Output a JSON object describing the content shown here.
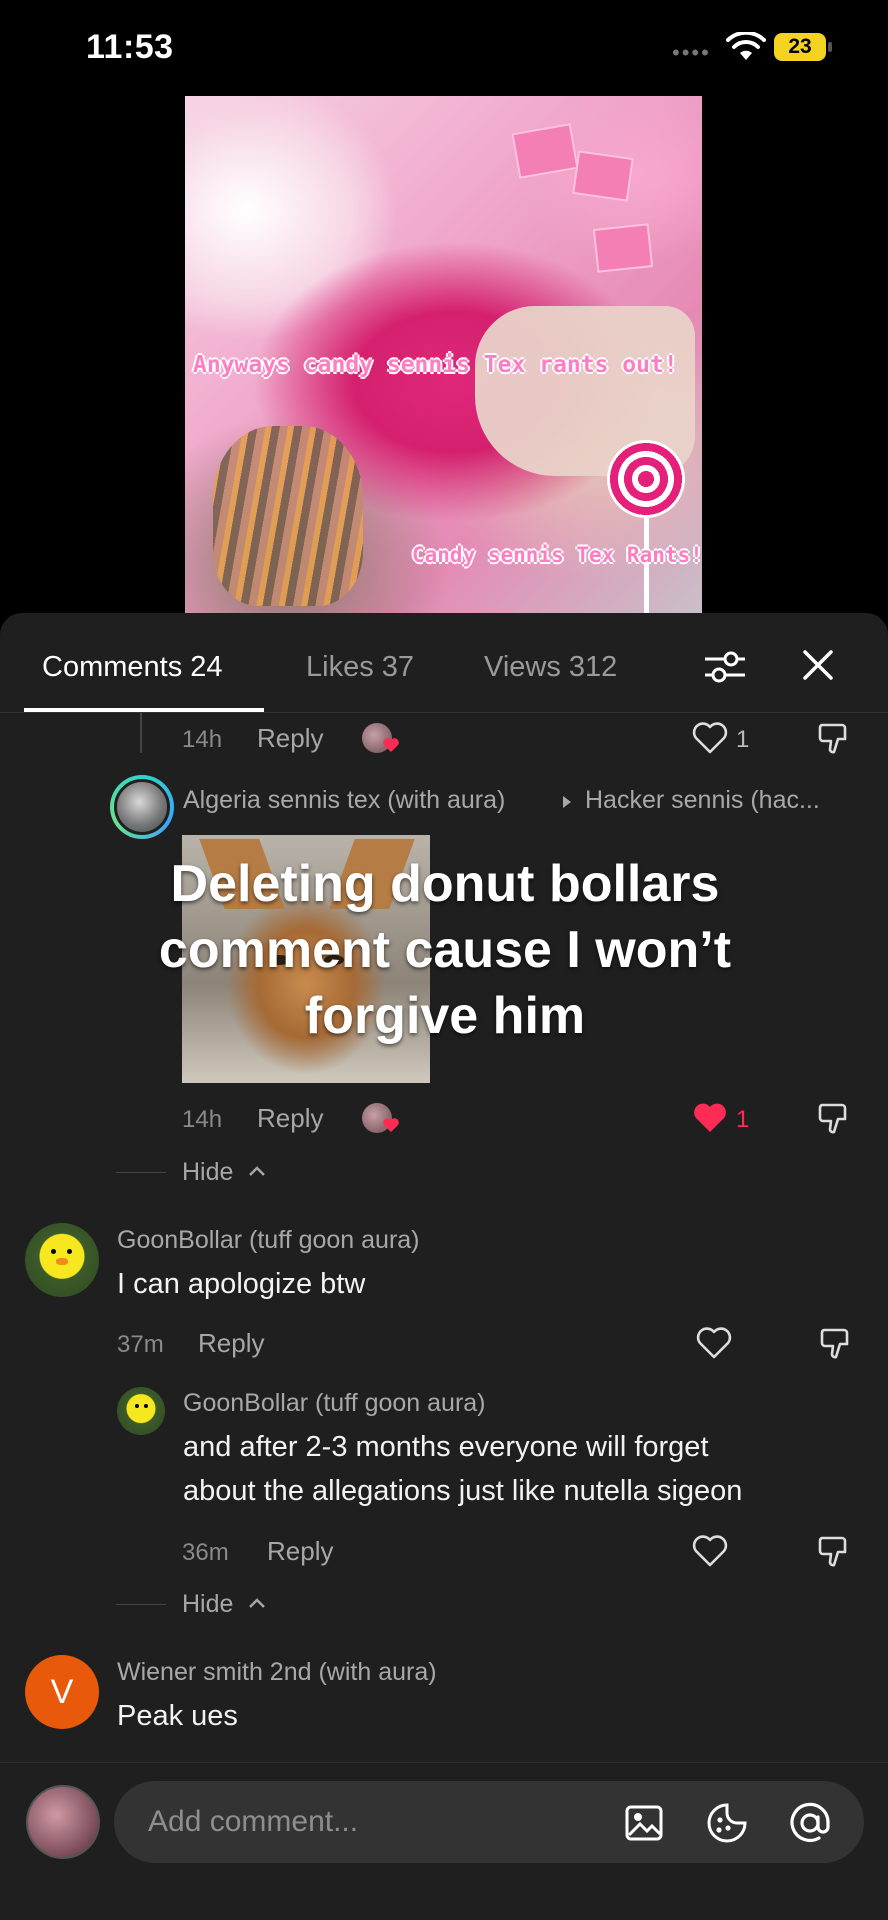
{
  "status_bar": {
    "time": "11:53",
    "battery": "23"
  },
  "video": {
    "caption_top": "Anyways candy sennis Tex rants out!",
    "caption_bottom": "Candy sennis Tex Rants!"
  },
  "tabs": [
    {
      "label": "Comments 24",
      "active": true
    },
    {
      "label": "Likes 37",
      "active": false
    },
    {
      "label": "Views 312",
      "active": false
    }
  ],
  "comments": {
    "thread_top": {
      "time": "14h",
      "reply_label": "Reply",
      "like_count": "1"
    },
    "algeria_reply": {
      "author": "Algeria sennis tex (with aura)",
      "reply_to": "Hacker sennis (hac...",
      "overlay_text": "Deleting donut bollars comment cause I won’t forgive him",
      "time": "14h",
      "reply_label": "Reply",
      "like_count": "1"
    },
    "hide_1": "Hide",
    "goon_comment": {
      "author": "GoonBollar (tuff goon aura)",
      "text": "I can apologize btw",
      "time": "37m",
      "reply_label": "Reply"
    },
    "goon_reply": {
      "author": "GoonBollar (tuff goon aura)",
      "text_line1": "and after 2-3 months everyone will forget",
      "text_line2": "about the allegations just like nutella sigeon",
      "time": "36m",
      "reply_label": "Reply"
    },
    "hide_2": "Hide",
    "wiener_comment": {
      "author": "Wiener smith 2nd (with aura)",
      "avatar_letter": "V",
      "text": "Peak ues"
    }
  },
  "composer": {
    "placeholder": "Add comment..."
  },
  "colors": {
    "liked_heart": "#fe2c55",
    "avatar_orange": "#e8590c",
    "battery": "#f3d222"
  },
  "icons": [
    "wifi-icon",
    "filter-icon",
    "close-icon",
    "heart-icon",
    "dislike-icon",
    "image-icon",
    "emoji-icon",
    "mention-icon",
    "chevron-up-icon"
  ]
}
